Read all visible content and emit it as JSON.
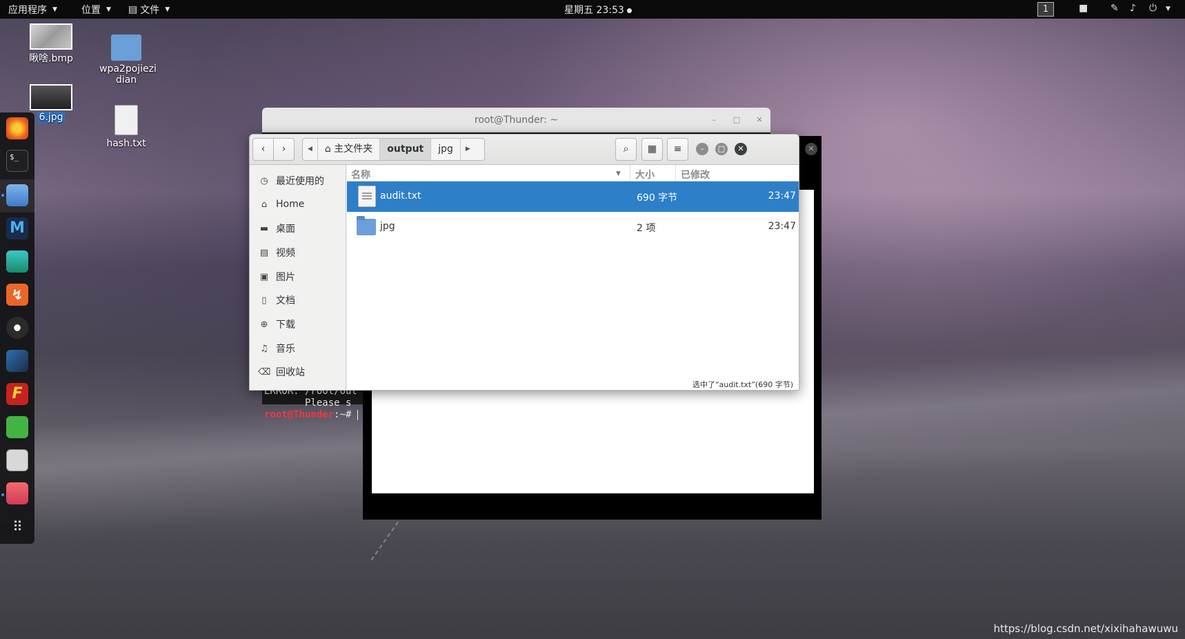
{
  "topbar": {
    "apps_menu": "应用程序",
    "places_menu": "位置",
    "files_menu": "文件",
    "clock": "星期五 23:53",
    "workspace": "1"
  },
  "desktop": {
    "icons": [
      {
        "label": "瞅啥.bmp"
      },
      {
        "label": "wpa2pojiezi"
      },
      {
        "label": "dian"
      },
      {
        "label": "6.jpg"
      },
      {
        "label": "hash.txt"
      }
    ]
  },
  "terminal": {
    "title": "root@Thunder: ~",
    "error_line": "ERROR: /root/out",
    "please_line": "       Please s",
    "prompt_user": "root@Thunder",
    "prompt_rest": ":~# "
  },
  "nautilus": {
    "path": [
      "主文件夹",
      "output",
      "jpg"
    ],
    "sidebar": [
      "最近使用的",
      "Home",
      "桌面",
      "视频",
      "图片",
      "文档",
      "下载",
      "音乐",
      "回收站"
    ],
    "columns": {
      "name": "名称",
      "size": "大小",
      "modified": "已修改"
    },
    "rows": [
      {
        "name": "audit.txt",
        "size": "690 字节",
        "modified": "23:47"
      },
      {
        "name": "jpg",
        "size": "2 项",
        "modified": "23:47"
      }
    ],
    "status": "选中了“audit.txt”(690 字节)"
  },
  "watermark": "https://blog.csdn.net/xixihahawuwu",
  "colors": {
    "selection": "#2d7fc7",
    "topbar": "#0b0b0b",
    "prompt": "#ee3a3a"
  }
}
